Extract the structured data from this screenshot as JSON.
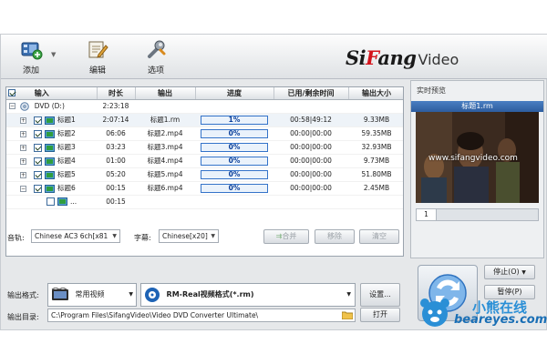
{
  "toolbar": {
    "add_label": "添加",
    "edit_label": "编辑",
    "options_label": "选项"
  },
  "logo": {
    "text_pre": "Si",
    "text_f": "F",
    "text_post": "ang",
    "text_video": "Video"
  },
  "table": {
    "headers": [
      "输入",
      "时长",
      "输出",
      "进度",
      "已用/剩余时间",
      "输出大小"
    ],
    "dvd_row": {
      "expander": "−",
      "name": "DVD (D:)",
      "duration": "2:23:18"
    },
    "rows": [
      {
        "expander": "+",
        "checked": true,
        "name": "标题1",
        "duration": "2:07:14",
        "output": "标题1.rm",
        "progress": "1%",
        "progress_value": 1,
        "time": "00:58|49:12",
        "size": "9.33MB"
      },
      {
        "expander": "+",
        "checked": true,
        "name": "标题2",
        "duration": "06:06",
        "output": "标题2.mp4",
        "progress": "0%",
        "progress_value": 0,
        "time": "00:00|00:00",
        "size": "59.35MB"
      },
      {
        "expander": "+",
        "checked": true,
        "name": "标题3",
        "duration": "03:23",
        "output": "标题3.mp4",
        "progress": "0%",
        "progress_value": 0,
        "time": "00:00|00:00",
        "size": "32.93MB"
      },
      {
        "expander": "+",
        "checked": true,
        "name": "标题4",
        "duration": "01:00",
        "output": "标题4.mp4",
        "progress": "0%",
        "progress_value": 0,
        "time": "00:00|00:00",
        "size": "9.73MB"
      },
      {
        "expander": "+",
        "checked": true,
        "name": "标题5",
        "duration": "05:20",
        "output": "标题5.mp4",
        "progress": "0%",
        "progress_value": 0,
        "time": "00:00|00:00",
        "size": "51.80MB"
      },
      {
        "expander": "−",
        "checked": true,
        "name": "标题6",
        "duration": "00:15",
        "output": "标题6.mp4",
        "progress": "0%",
        "progress_value": 0,
        "time": "00:00|00:00",
        "size": "2.45MB"
      }
    ],
    "sub_row": {
      "checked": false,
      "name": "...",
      "duration": "00:15"
    }
  },
  "audio": {
    "label": "音轨:",
    "value": "Chinese AC3 6ch[x81"
  },
  "subtitle": {
    "label": "字幕:",
    "value": "Chinese[x20]"
  },
  "actions": {
    "merge_label": "合并",
    "remove_label": "移除",
    "clear_label": "清空"
  },
  "output_format": {
    "label": "输出格式:",
    "category": "常用视频",
    "format_name": "RM-Real视频格式(*.rm)",
    "settings_label": "设置..."
  },
  "output_dir": {
    "label": "输出目录:",
    "path": "C:\\Program Files\\SifangVideo\\Video DVD Converter Ultimate\\",
    "open_label": "打开"
  },
  "preview": {
    "title": "实时预览",
    "file_name": "标题1.rm",
    "watermark": "www.sifangvideo.com",
    "page": "1"
  },
  "convert": {
    "stop_label": "停止(O)",
    "pause_label": "暂停(P)"
  },
  "site_watermark": {
    "cn": "小熊在线",
    "en": "beareyes.com"
  },
  "colors": {
    "accent": "#3473c9",
    "progress_text": "#0a3f9a",
    "brand_red": "#d4141c",
    "preview_header": "#2d5d9f"
  }
}
